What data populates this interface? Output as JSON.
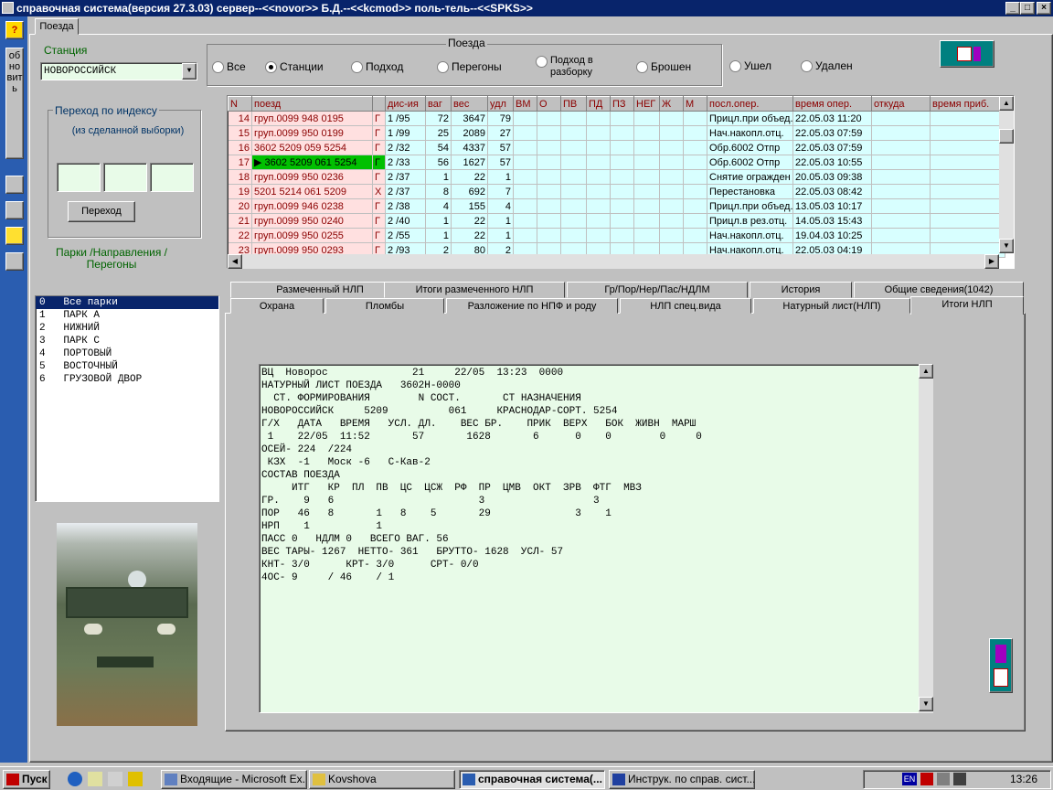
{
  "title": "справочная система(версия 27.3.03) сервер--<<novor>> Б.Д.--<<kcmod>> поль-тель--<<SPKS>>",
  "left_strip": {
    "help": "?",
    "refresh": "обновить"
  },
  "main_tab": "Поезда",
  "station": {
    "label": "Станция",
    "value": "НОВОРОССИЙСК"
  },
  "trains_group": {
    "title": "Поезда",
    "options": [
      "Все",
      "Станции",
      "Подход",
      "Перегоны",
      "Подход в разборку",
      "Брошен",
      "Ушел",
      "Удален"
    ],
    "selected": "Станции"
  },
  "jump": {
    "title": "Переход  по индексу",
    "subtitle": "(из сделанной выборки)",
    "button": "Переход"
  },
  "parks_label": "Парки /Направления / Перегоны",
  "parks": [
    "0   Все парки",
    "1   ПАРК А",
    "2   НИЖНИЙ",
    "3   ПАРК С",
    "4   ПОРТОВЫЙ",
    "5   ВОСТОЧНЫЙ",
    "6   ГРУЗОВОЙ ДВОР"
  ],
  "grid": {
    "columns": [
      "N",
      "поезд",
      "",
      "дис-ия",
      "ваг",
      "вес",
      "удл",
      "ВМ",
      "О",
      "ПВ",
      "ПД",
      "ПЗ",
      "НЕГ",
      "Ж",
      "М",
      "посл.опер.",
      "время опер.",
      "откуда",
      "время приб."
    ],
    "rows": [
      [
        "14",
        "груп.0099 948 0195",
        "Г",
        "1 /95",
        "72",
        "3647",
        "79",
        "Прицл.при объед.",
        "22.05.03 11:20"
      ],
      [
        "15",
        "груп.0099 950 0199",
        "Г",
        "1 /99",
        "25",
        "2089",
        "27",
        "Нач.накопл.отц.",
        "22.05.03 07:59"
      ],
      [
        "16",
        "3602 5209 059 5254",
        "Г",
        "2 /32",
        "54",
        "4337",
        "57",
        "Обр.6002 Отпр",
        "22.05.03 07:59"
      ],
      [
        "17",
        "3602 5209 061 5254",
        "Г",
        "2 /33",
        "56",
        "1627",
        "57",
        "Обр.6002 Отпр",
        "22.05.03 10:55"
      ],
      [
        "18",
        "груп.0099 950 0236",
        "Г",
        "2 /37",
        "1",
        "22",
        "1",
        "Снятие огражден",
        "20.05.03 09:38"
      ],
      [
        "19",
        "5201 5214 061 5209",
        "Х",
        "2 /37",
        "8",
        "692",
        "7",
        "Перестановка",
        "22.05.03 08:42"
      ],
      [
        "20",
        "груп.0099 946 0238",
        "Г",
        "2 /38",
        "4",
        "155",
        "4",
        "Прицл.при объед.",
        "13.05.03 10:17"
      ],
      [
        "21",
        "груп.0099 950 0240",
        "Г",
        "2 /40",
        "1",
        "22",
        "1",
        "Прицл.в рез.отц.",
        "14.05.03 15:43"
      ],
      [
        "22",
        "груп.0099 950 0255",
        "Г",
        "2 /55",
        "1",
        "22",
        "1",
        "Нач.накопл.отц.",
        "19.04.03 10:25"
      ],
      [
        "23",
        "груп.0099 950 0293",
        "Г",
        "2 /93",
        "2",
        "80",
        "2",
        "Нач.накопл.отц.",
        "22.05.03 04:19"
      ]
    ],
    "selected_row": "17"
  },
  "tabs_row1": [
    "Размеченный НЛП",
    "Итоги размеченного НЛП",
    "Гр/Пор/Нер/Пас/НДЛМ",
    "История",
    "Общие сведения(1042)"
  ],
  "tabs_row2": [
    "Охрана",
    "Пломбы",
    "Разложение по НПФ и роду",
    "НЛП спец.вида",
    "Натурный лист(НЛП)",
    "Итоги НЛП"
  ],
  "active_tab": "Итоги НЛП",
  "report": "ВЦ  Новорос              21     22/05  13:23  0000\nНАТУРНЫЙ ЛИСТ ПОЕЗДА   3602Н-0000\n  СТ. ФОРМИРОВАНИЯ        N СОСТ.       СТ НАЗНАЧЕНИЯ\nНОВОРОССИЙСК     5209          061     КРАСНОДАР-СОРТ. 5254\nГ/Х   ДАТА   ВРЕМЯ   УСЛ. ДЛ.    ВЕС БР.    ПРИК  ВЕРХ   БОК  ЖИВН  МАРШ\n 1    22/05  11:52       57       1628       6      0    0        0     0\nОСЕЙ- 224  /224\n КЗХ  -1   Моск -6   С-Кав-2\nСОСТАВ ПОЕЗДА\n     ИТГ   КР  ПЛ  ПВ  ЦС  ЦСЖ  РФ  ПР  ЦМВ  ОКТ  ЗРВ  ФТГ  МВЗ\nГР.    9   6                        3                  3\nПОР   46   8       1   8    5       29              3    1\nНРП    1           1\nПАСС 0   НДЛМ 0   ВСЕГО ВАГ. 56\nВЕС ТАРЫ- 1267  НЕТТО- 361   БРУТТО- 1628  УСЛ- 57\nКНТ- 3/0      КРТ- 3/0      СРТ- 0/0\n4ОС- 9     / 46    / 1",
  "taskbar": {
    "start": "Пуск",
    "items": [
      "Входящие - Microsoft Ex...",
      "Kovshova",
      "справочная система(...",
      "Инструк. по справ. сист..."
    ],
    "active": "справочная система(...",
    "lang": "EN",
    "clock": "13:26"
  }
}
